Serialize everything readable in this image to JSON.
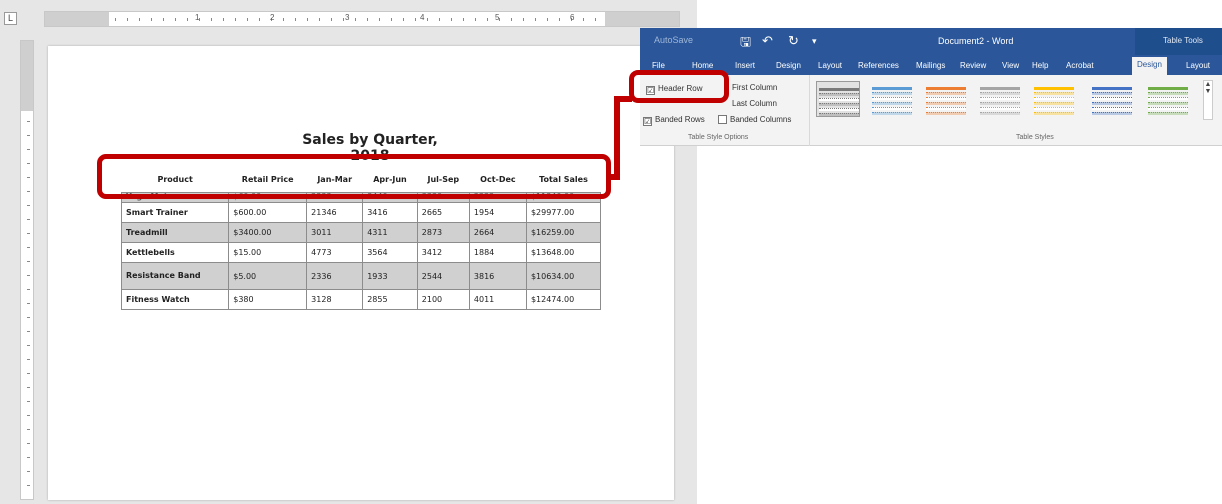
{
  "ruler": {
    "corner_label": "L",
    "numbers": [
      "1",
      "2",
      "3",
      "4",
      "5",
      "6"
    ]
  },
  "document": {
    "title": "Sales by Quarter, 2018",
    "table": {
      "headers": [
        "Product",
        "Retail Price",
        "Jan-Mar",
        "Apr-Jun",
        "Jul-Sep",
        "Oct-Dec",
        "Total Sales"
      ],
      "partial_row": [
        "Yoga Mat",
        "$60.00",
        "2333",
        "3440",
        "3330",
        "2222",
        "$11340.00"
      ],
      "rows": [
        [
          "Smart Trainer",
          "$600.00",
          "21346",
          "3416",
          "2665",
          "1954",
          "$29977.00"
        ],
        [
          "Treadmill",
          "$3400.00",
          "3011",
          "4311",
          "2873",
          "2664",
          "$16259.00"
        ],
        [
          "Kettlebells",
          "$15.00",
          "4773",
          "3564",
          "3412",
          "1884",
          "$13648.00"
        ],
        [
          "Resistance Band",
          "$5.00",
          "2336",
          "1933",
          "2544",
          "3816",
          "$10634.00"
        ],
        [
          "Fitness Watch",
          "$380",
          "3128",
          "2855",
          "2100",
          "4011",
          "$12474.00"
        ]
      ]
    }
  },
  "ribbon": {
    "autosave": "AutoSave",
    "doc_name": "Document2 - Word",
    "context_label": "Table Tools",
    "qa_icons": [
      "save-icon",
      "undo-icon",
      "redo-icon"
    ],
    "tabs": [
      "File",
      "Home",
      "Insert",
      "Design",
      "Layout",
      "References",
      "Mailings",
      "Review",
      "View",
      "Help",
      "Acrobat",
      "Design",
      "Layout"
    ],
    "active_tab_index": 11,
    "options": {
      "header_row": "Header Row",
      "first_column": "First Column",
      "last_column": "Last Column",
      "banded_rows": "Banded Rows",
      "banded_columns": "Banded Columns",
      "group_label": "Table Style Options",
      "checked": {
        "header_row": "☑",
        "banded_rows": "☑"
      }
    },
    "styles_group_label": "Table Styles",
    "style_colors": [
      "#7a7a7a",
      "#5b9bd5",
      "#ed7d31",
      "#a5a5a5",
      "#ffc000",
      "#4472c4",
      "#70ad47"
    ]
  },
  "colors": {
    "word_blue": "#2b579a",
    "callout_red": "#c00000",
    "row_shade": "#d0d0d0"
  }
}
